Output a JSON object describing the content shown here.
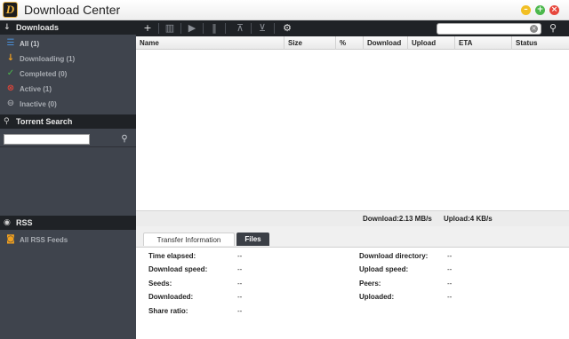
{
  "app": {
    "title": "Download Center",
    "logo_letter": "D"
  },
  "window_controls": {
    "minimize": "–",
    "maximize": "+",
    "close": "×"
  },
  "sidebar": {
    "downloads_header": "Downloads",
    "downloads_items": [
      {
        "label": "All (1)",
        "icon": "list-icon",
        "color": "#4a90d9"
      },
      {
        "label": "Downloading (1)",
        "icon": "arrow-down-icon",
        "color": "#f0a020"
      },
      {
        "label": "Completed (0)",
        "icon": "check-icon",
        "color": "#4cb84c"
      },
      {
        "label": "Active (1)",
        "icon": "active-icon",
        "color": "#d9453a"
      },
      {
        "label": "Inactive (0)",
        "icon": "inactive-icon",
        "color": "#9a9da3"
      }
    ],
    "search_header": "Torrent Search",
    "search_placeholder": "",
    "rss_header": "RSS",
    "rss_items": [
      {
        "label": "All RSS Feeds",
        "icon": "rss-icon",
        "color": "#f0a020"
      }
    ]
  },
  "toolbar": {
    "buttons": [
      "add-icon",
      "delete-icon",
      "start-icon",
      "pause-icon",
      "move-up-icon",
      "move-down-icon",
      "settings-icon"
    ],
    "search_placeholder": ""
  },
  "table": {
    "columns": [
      "Name",
      "Size",
      "%",
      "Download",
      "Upload",
      "ETA",
      "Status"
    ],
    "rows": []
  },
  "status": {
    "download": "Download:2.13 MB/s",
    "upload": "Upload:4 KB/s"
  },
  "detail_tabs": [
    "Transfer Information",
    "Files"
  ],
  "detail": {
    "left": [
      {
        "label": "Time elapsed:",
        "value": "--"
      },
      {
        "label": "Download speed:",
        "value": "--"
      },
      {
        "label": "Seeds:",
        "value": "--"
      },
      {
        "label": "Downloaded:",
        "value": "--"
      },
      {
        "label": "Share ratio:",
        "value": "--"
      }
    ],
    "right": [
      {
        "label": "Download directory:",
        "value": "--"
      },
      {
        "label": "Upload speed:",
        "value": "--"
      },
      {
        "label": "Peers:",
        "value": "--"
      },
      {
        "label": "Uploaded:",
        "value": "--"
      }
    ]
  },
  "colors": {
    "sidebar_bg": "#3f444d",
    "header_bg": "#1f2226",
    "minimize": "#f1bf24",
    "maximize": "#4cb84c",
    "close": "#e7473c"
  }
}
